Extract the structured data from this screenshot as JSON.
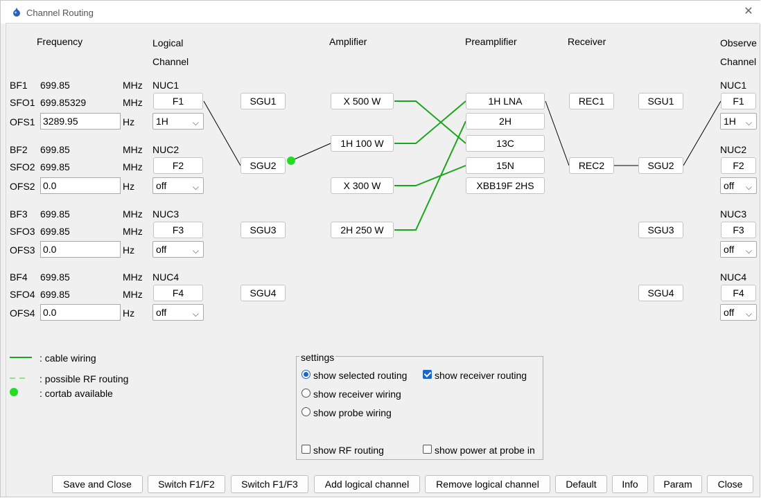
{
  "window": {
    "title": "Channel Routing",
    "close_glyph": "✕"
  },
  "headers": {
    "frequency": "Frequency",
    "logical1": "Logical",
    "logical2": "Channel",
    "amplifier": "Amplifier",
    "preamplifier": "Preamplifier",
    "receiver": "Receiver",
    "observe1": "Observe",
    "observe2": "Channel"
  },
  "channels": [
    {
      "bf_label": "BF1",
      "bf_value": "699.85",
      "bf_unit": "MHz",
      "nuc": "NUC1",
      "sfo_label": "SFO1",
      "sfo_value": "699.85329",
      "sfo_unit": "MHz",
      "f_button": "F1",
      "ofs_label": "OFS1",
      "ofs_value": "3289.95",
      "ofs_unit": "Hz",
      "nucleus": "1H",
      "sgu": "SGU1",
      "obs_nuc": "NUC1",
      "obs_f": "F1",
      "obs_sel": "1H"
    },
    {
      "bf_label": "BF2",
      "bf_value": "699.85",
      "bf_unit": "MHz",
      "nuc": "NUC2",
      "sfo_label": "SFO2",
      "sfo_value": "699.85",
      "sfo_unit": "MHz",
      "f_button": "F2",
      "ofs_label": "OFS2",
      "ofs_value": "0.0",
      "ofs_unit": "Hz",
      "nucleus": "off",
      "sgu": "SGU2",
      "obs_nuc": "NUC2",
      "obs_f": "F2",
      "obs_sel": "off"
    },
    {
      "bf_label": "BF3",
      "bf_value": "699.85",
      "bf_unit": "MHz",
      "nuc": "NUC3",
      "sfo_label": "SFO3",
      "sfo_value": "699.85",
      "sfo_unit": "MHz",
      "f_button": "F3",
      "ofs_label": "OFS3",
      "ofs_value": "0.0",
      "ofs_unit": "Hz",
      "nucleus": "off",
      "sgu": "SGU3",
      "obs_nuc": "NUC3",
      "obs_f": "F3",
      "obs_sel": "off"
    },
    {
      "bf_label": "BF4",
      "bf_value": "699.85",
      "bf_unit": "MHz",
      "nuc": "NUC4",
      "sfo_label": "SFO4",
      "sfo_value": "699.85",
      "sfo_unit": "MHz",
      "f_button": "F4",
      "ofs_label": "OFS4",
      "ofs_value": "0.0",
      "ofs_unit": "Hz",
      "nucleus": "off",
      "sgu": "SGU4",
      "obs_nuc": "NUC4",
      "obs_f": "F4",
      "obs_sel": "off"
    }
  ],
  "amplifiers": [
    "X 500 W",
    "1H 100 W",
    "X 300 W",
    "2H 250 W"
  ],
  "preamplifiers": [
    "1H LNA",
    "2H",
    "13C",
    "15N",
    "XBB19F 2HS"
  ],
  "receivers": [
    "REC1",
    "REC2"
  ],
  "observe_sgus": [
    "SGU1",
    "SGU2",
    "SGU3",
    "SGU4"
  ],
  "legend": {
    "cable": ": cable wiring",
    "rf": ": possible RF routing",
    "cortab": ": cortab available"
  },
  "settings": {
    "title": "settings",
    "selected_routing": "show selected routing",
    "receiver_routing": "show receiver routing",
    "receiver_wiring": "show receiver wiring",
    "probe_wiring": "show probe wiring",
    "rf_routing": "show RF routing",
    "power_probe": "show power at probe in",
    "selected_routing_on": true,
    "receiver_routing_checked": true,
    "rf_routing_checked": false,
    "power_probe_checked": false
  },
  "buttons": {
    "save_close": "Save and Close",
    "switch12": "Switch F1/F2",
    "switch13": "Switch F1/F3",
    "add": "Add logical channel",
    "remove": "Remove logical channel",
    "default": "Default",
    "info": "Info",
    "param": "Param",
    "close": "Close"
  },
  "colors": {
    "wire_green": "#1aa51a",
    "cortab_green": "#22dd22",
    "accent": "#1a66c9"
  }
}
